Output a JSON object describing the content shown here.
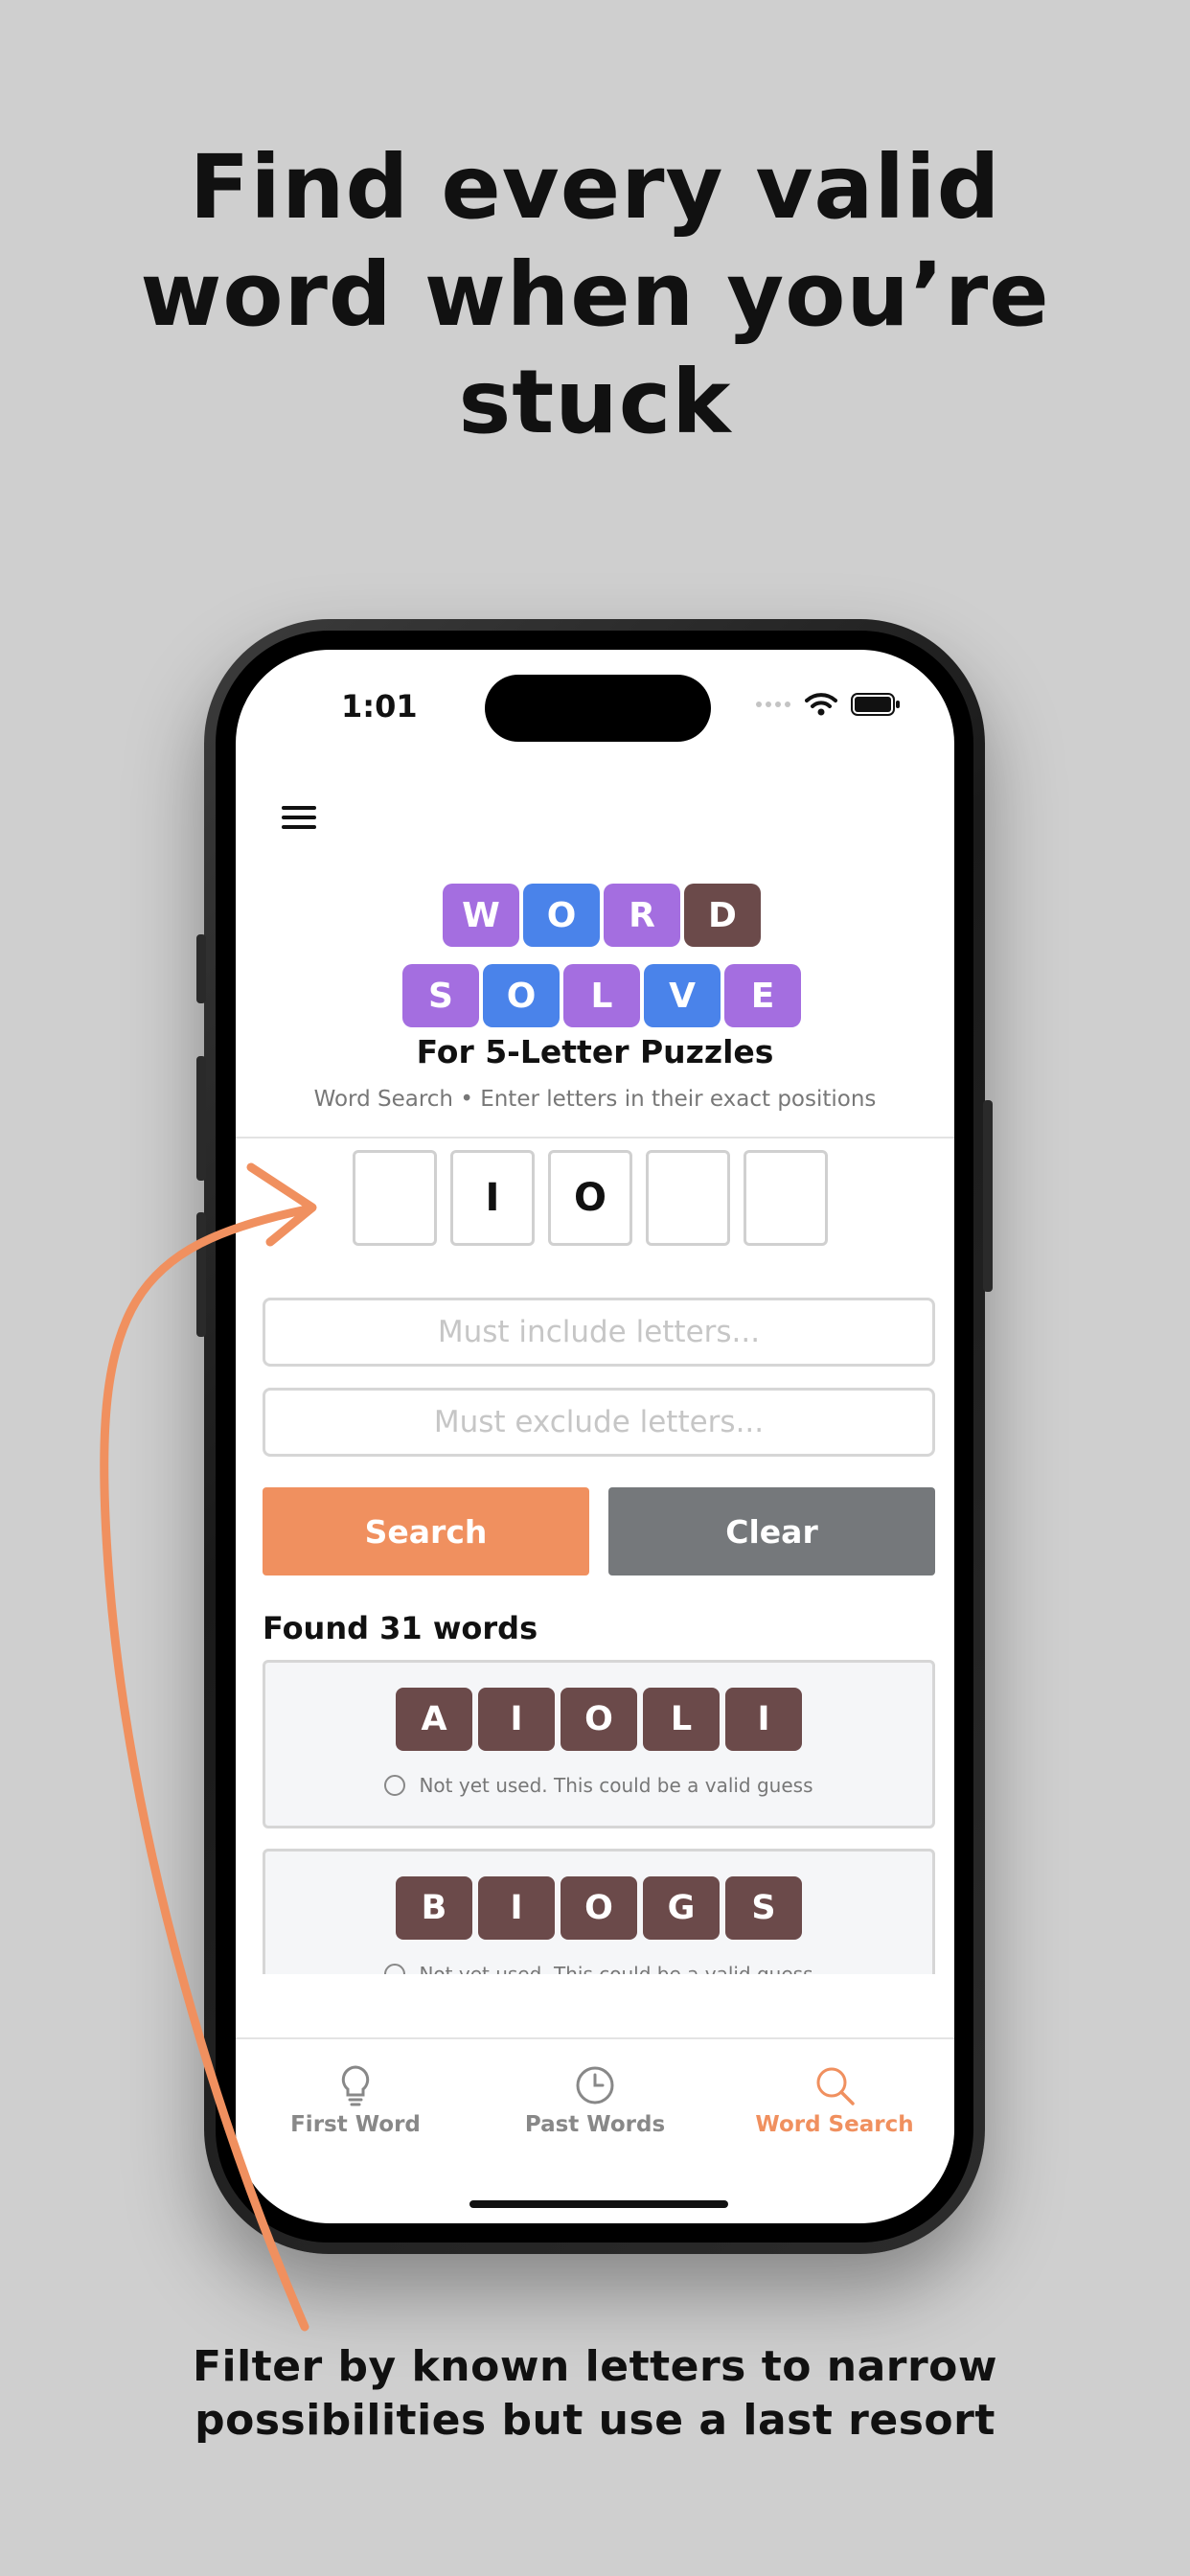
{
  "headline": [
    "Find every valid",
    "word when you’re",
    "stuck"
  ],
  "caption": [
    "Filter by known letters to narrow",
    "possibilities but use a last resort"
  ],
  "status_bar": {
    "time": "1:01"
  },
  "logo": {
    "row1": [
      {
        "letter": "W",
        "color": "#a46ee0"
      },
      {
        "letter": "O",
        "color": "#4a83ea"
      },
      {
        "letter": "R",
        "color": "#a46ee0"
      },
      {
        "letter": "D",
        "color": "#6b4a4a"
      }
    ],
    "row2": [
      {
        "letter": "S",
        "color": "#a46ee0"
      },
      {
        "letter": "O",
        "color": "#4a83ea"
      },
      {
        "letter": "L",
        "color": "#a46ee0"
      },
      {
        "letter": "V",
        "color": "#4a83ea"
      },
      {
        "letter": "E",
        "color": "#a46ee0"
      }
    ]
  },
  "app": {
    "title": "For 5-Letter Puzzles",
    "subtitle": "Word Search • Enter letters in their exact positions"
  },
  "slots": [
    "",
    "I",
    "O",
    "",
    ""
  ],
  "inputs": {
    "include_placeholder": "Must include letters...",
    "exclude_placeholder": "Must exclude letters..."
  },
  "buttons": {
    "search": "Search",
    "clear": "Clear"
  },
  "results": {
    "found_label": "Found 31 words",
    "words": [
      {
        "letters": [
          "A",
          "I",
          "O",
          "L",
          "I"
        ],
        "note": "Not yet used. This could be a valid guess"
      },
      {
        "letters": [
          "B",
          "I",
          "O",
          "G",
          "S"
        ],
        "note": "Not yet used. This could be a valid guess"
      }
    ]
  },
  "tabs": [
    {
      "label": "First Word",
      "icon": "lightbulb-icon",
      "active": false
    },
    {
      "label": "Past Words",
      "icon": "clock-icon",
      "active": false
    },
    {
      "label": "Word Search",
      "icon": "search-icon",
      "active": true
    }
  ],
  "colors": {
    "accent": "#f0905f",
    "clear_button": "#75787b",
    "tile_brown": "#6b4a4a",
    "tile_purple": "#a46ee0",
    "tile_blue": "#4a83ea",
    "background": "#cfcfcf"
  }
}
